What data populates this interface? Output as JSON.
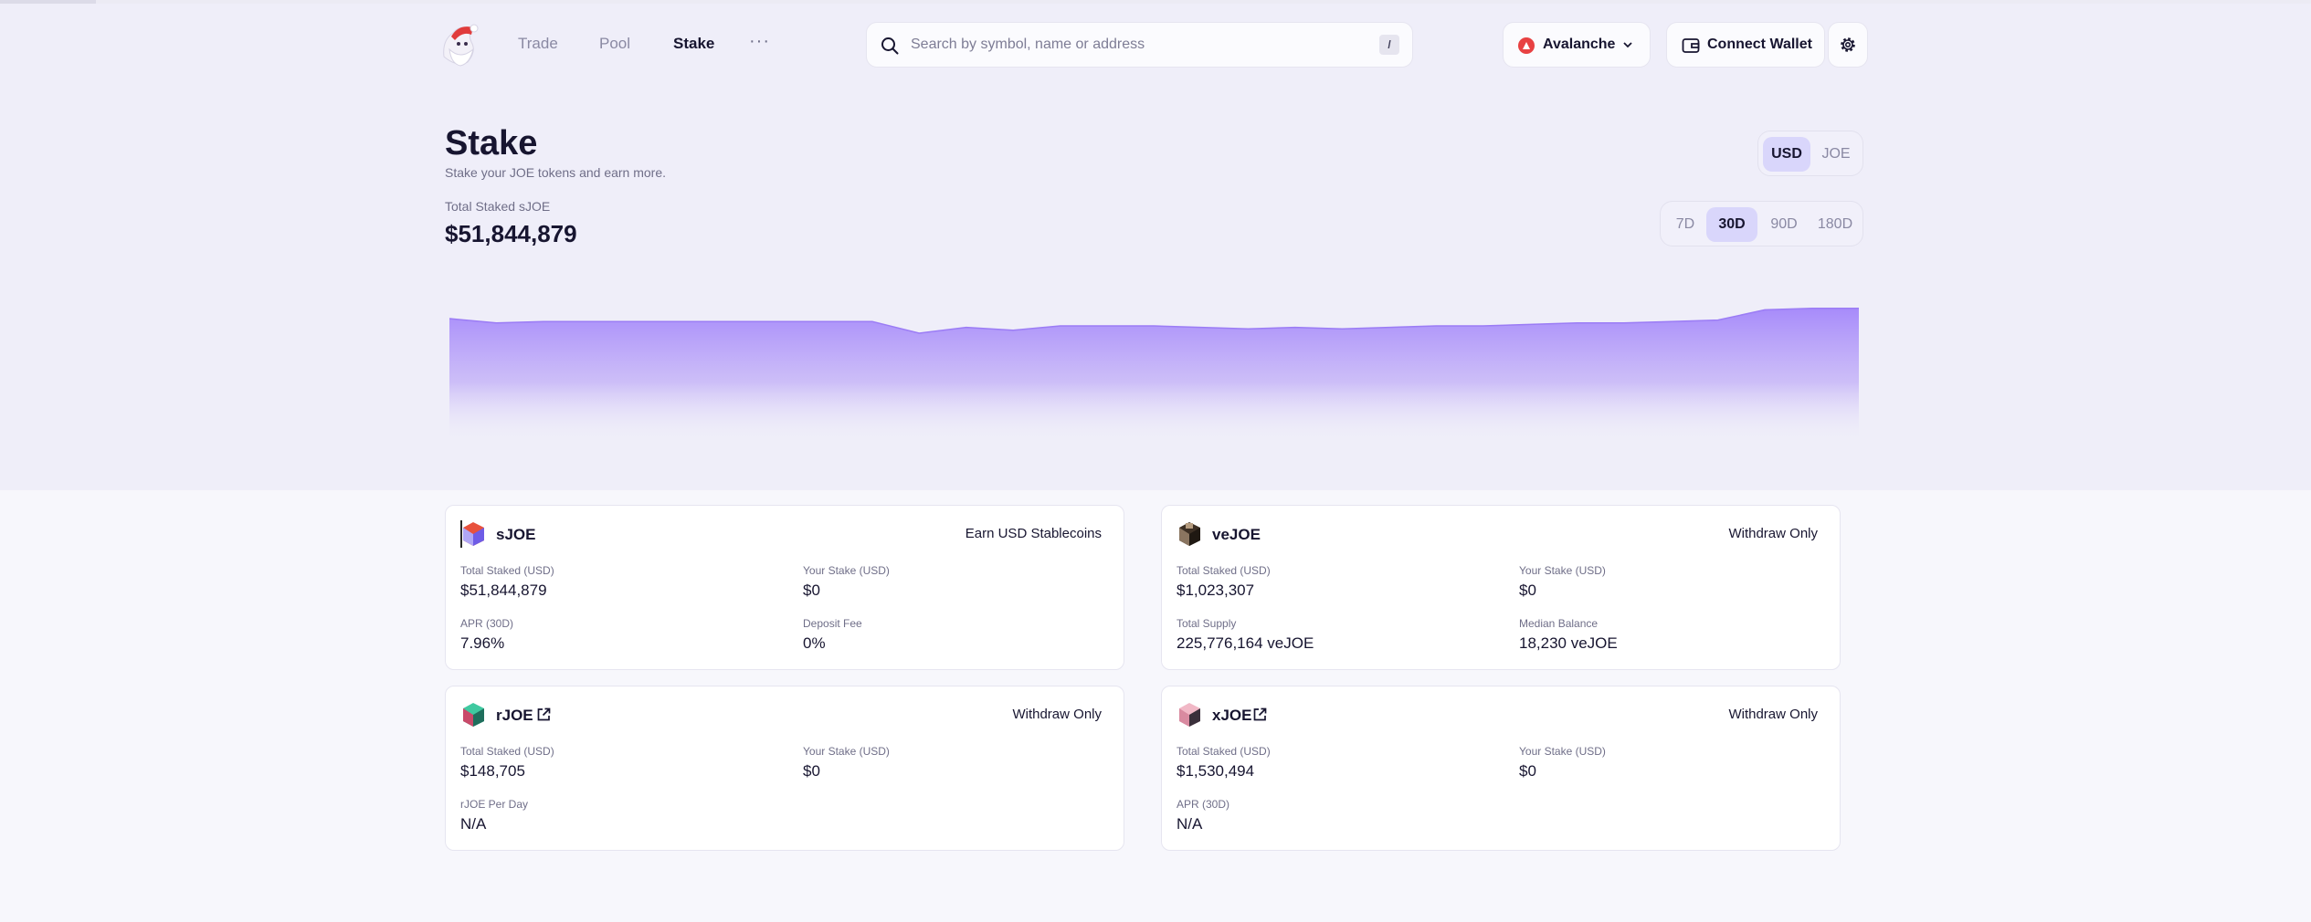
{
  "nav": {
    "items": [
      {
        "label": "Trade"
      },
      {
        "label": "Pool"
      },
      {
        "label": "Stake"
      }
    ],
    "more_label": "···"
  },
  "search": {
    "placeholder": "Search by symbol, name or address",
    "value": "",
    "shortcut": "/"
  },
  "network": {
    "label": "Avalanche"
  },
  "wallet": {
    "label": "Connect Wallet"
  },
  "page": {
    "title": "Stake",
    "subtitle": "Stake your JOE tokens and earn more.",
    "total_label": "Total Staked sJOE",
    "total_value": "$51,844,879"
  },
  "currency_toggle": {
    "options": [
      "USD",
      "JOE"
    ],
    "selected": "USD"
  },
  "range_toggle": {
    "options": [
      "7D",
      "30D",
      "90D",
      "180D"
    ],
    "selected": "30D"
  },
  "chart_data": {
    "type": "area",
    "title": "",
    "xlabel": "",
    "ylabel": "",
    "grid": false,
    "ylim": [
      0,
      100
    ],
    "values": [
      85,
      82,
      83,
      83,
      83,
      83,
      83,
      83,
      83,
      83,
      75,
      79,
      77,
      80,
      80,
      80,
      79,
      78,
      79,
      78,
      79,
      80,
      80,
      81,
      82,
      82,
      83,
      84,
      91,
      92,
      92
    ],
    "color": "#a78bfa"
  },
  "cards": {
    "sjoe": {
      "name": "sJOE",
      "tag": "Earn USD Stablecoins",
      "f1_label": "Total Staked (USD)",
      "f1_value": "$51,844,879",
      "f2_label": "Your Stake (USD)",
      "f2_value": "$0",
      "f3_label": "APR (30D)",
      "f3_value": "7.96%",
      "f4_label": "Deposit Fee",
      "f4_value": "0%"
    },
    "vejoe": {
      "name": "veJOE",
      "tag": "Withdraw Only",
      "f1_label": "Total Staked (USD)",
      "f1_value": "$1,023,307",
      "f2_label": "Your Stake (USD)",
      "f2_value": "$0",
      "f3_label": "Total Supply",
      "f3_value": "225,776,164 veJOE",
      "f4_label": "Median Balance",
      "f4_value": "18,230 veJOE"
    },
    "rjoe": {
      "name": "rJOE",
      "tag": "Withdraw Only",
      "f1_label": "Total Staked (USD)",
      "f1_value": "$148,705",
      "f2_label": "Your Stake (USD)",
      "f2_value": "$0",
      "f3_label": "rJOE Per Day",
      "f3_value": "N/A"
    },
    "xjoe": {
      "name": "xJOE",
      "tag": "Withdraw Only",
      "f1_label": "Total Staked (USD)",
      "f1_value": "$1,530,494",
      "f2_label": "Your Stake (USD)",
      "f2_value": "$0",
      "f3_label": "APR (30D)",
      "f3_value": "N/A"
    }
  },
  "colors": {
    "accent": "#a78bfa",
    "active_toggle": "#d9d6fb",
    "hero_bg": "#efeef9",
    "avalanche": "#e84142"
  },
  "icons": {
    "search": "search-icon",
    "network": "avalanche-icon",
    "wallet": "wallet-icon",
    "settings": "gear-icon",
    "external": "external-link-icon"
  }
}
